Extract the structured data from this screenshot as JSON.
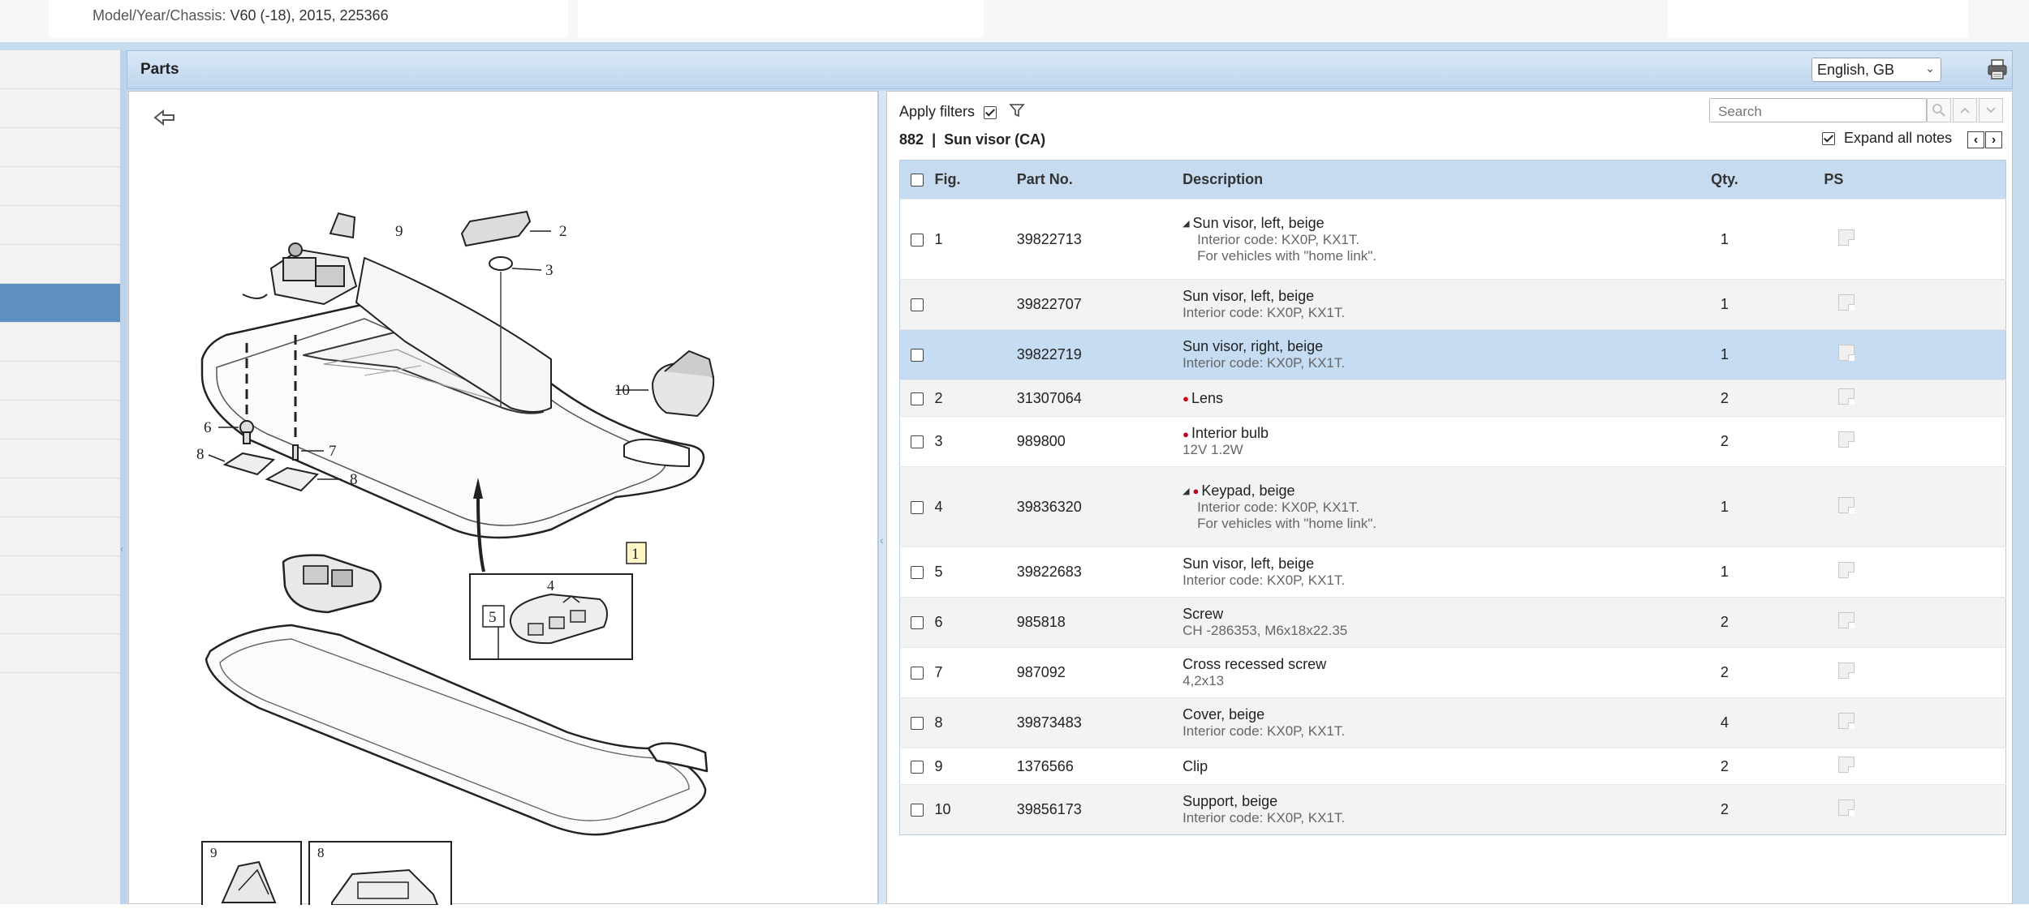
{
  "header": {
    "model_label": "Model/Year/Chassis:",
    "model_value": "V60 (-18), 2015, 225366"
  },
  "parts_panel": {
    "title": "Parts",
    "language": "English, GB",
    "print_icon": "printer-icon"
  },
  "drawing": {
    "back_icon": "back-arrow-icon",
    "callouts": [
      "9",
      "2",
      "3",
      "10",
      "6",
      "7",
      "8",
      "8",
      "1",
      "4",
      "5",
      "9",
      "8"
    ]
  },
  "filters": {
    "apply_filters_label": "Apply filters",
    "apply_filters_checked": true,
    "filter_icon": "funnel-icon",
    "group_number": "882",
    "group_separator": "|",
    "group_name": "Sun visor (CA)",
    "search_placeholder": "Search",
    "expand_notes_label": "Expand all notes",
    "expand_notes_checked": true,
    "notes_prev": "‹",
    "notes_next": "›"
  },
  "table": {
    "columns": {
      "fig": "Fig.",
      "part": "Part No.",
      "desc": "Description",
      "qty": "Qty.",
      "ps": "PS"
    },
    "rows": [
      {
        "fig": "1",
        "part": "39822713",
        "desc": "Sun visor, left, beige",
        "notes": [
          "Interior code: KX0P, KX1T.",
          "For vehicles with \"home link\"."
        ],
        "qty": "1"
      },
      {
        "fig": "",
        "part": "39822707",
        "desc": "Sun visor, left, beige",
        "notes": [
          "Interior code: KX0P, KX1T."
        ],
        "qty": "1"
      },
      {
        "fig": "",
        "part": "39822719",
        "desc": "Sun visor, right, beige",
        "notes": [
          "Interior code: KX0P, KX1T."
        ],
        "qty": "1"
      },
      {
        "fig": "2",
        "part": "31307064",
        "desc": "Lens",
        "notes": [],
        "qty": "2"
      },
      {
        "fig": "3",
        "part": "989800",
        "desc": "Interior bulb",
        "notes": [
          "12V 1.2W"
        ],
        "qty": "2"
      },
      {
        "fig": "4",
        "part": "39836320",
        "desc": "Keypad, beige",
        "notes": [
          "Interior code: KX0P, KX1T.",
          "For vehicles with \"home link\"."
        ],
        "qty": "1"
      },
      {
        "fig": "5",
        "part": "39822683",
        "desc": "Sun visor, left, beige",
        "notes": [
          "Interior code: KX0P, KX1T."
        ],
        "qty": "1"
      },
      {
        "fig": "6",
        "part": "985818",
        "desc": "Screw",
        "notes": [
          "CH -286353, M6x18x22.35"
        ],
        "qty": "2"
      },
      {
        "fig": "7",
        "part": "987092",
        "desc": "Cross recessed screw",
        "notes": [
          "4,2x13"
        ],
        "qty": "2"
      },
      {
        "fig": "8",
        "part": "39873483",
        "desc": "Cover, beige",
        "notes": [
          "Interior code: KX0P, KX1T."
        ],
        "qty": "4"
      },
      {
        "fig": "9",
        "part": "1376566",
        "desc": "Clip",
        "notes": [],
        "qty": "2"
      },
      {
        "fig": "10",
        "part": "39856173",
        "desc": "Support, beige",
        "notes": [
          "Interior code: KX0P, KX1T."
        ],
        "qty": "2"
      }
    ]
  }
}
